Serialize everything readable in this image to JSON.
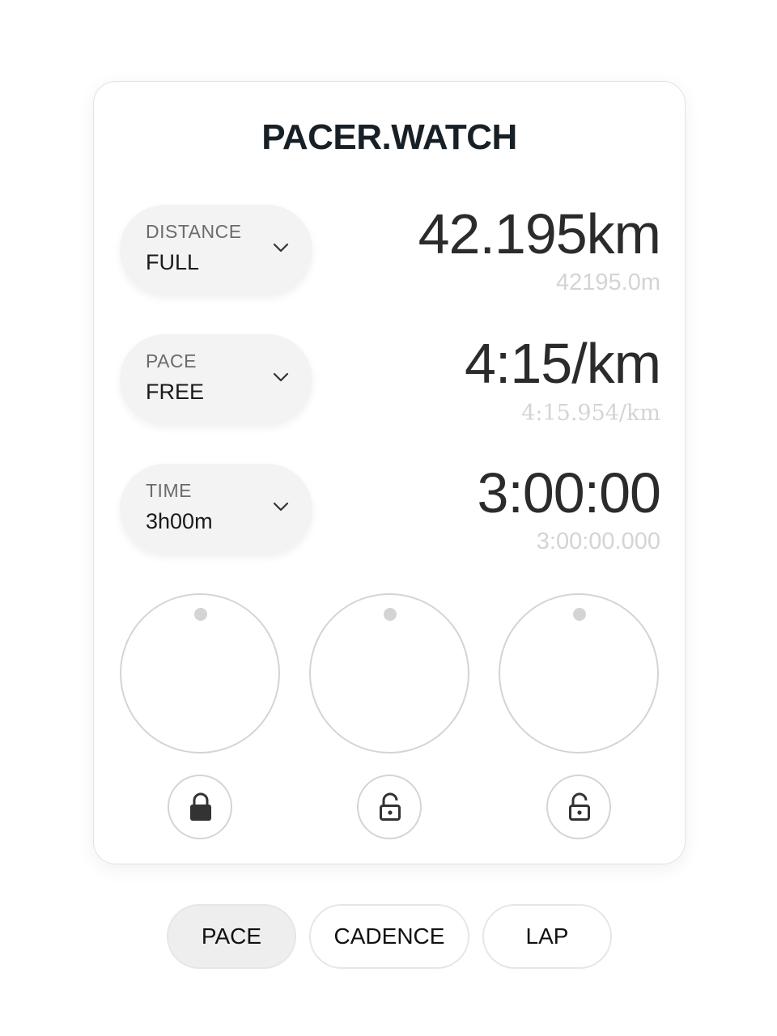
{
  "app": {
    "title": "PACER.WATCH"
  },
  "rows": [
    {
      "label": "DISTANCE",
      "selected": "FULL",
      "value": "42.195km",
      "precise": "42195.0m"
    },
    {
      "label": "PACE",
      "selected": "FREE",
      "value": "4:15/km",
      "precise": "4:15.954/km"
    },
    {
      "label": "TIME",
      "selected": "3h00m",
      "value": "3:00:00",
      "precise": "3:00:00.000"
    }
  ],
  "dials": [
    {
      "name": "distance-dial",
      "lock_state": "locked",
      "lock_icon": "lock-closed-icon"
    },
    {
      "name": "pace-dial",
      "lock_state": "unlocked",
      "lock_icon": "lock-open-icon"
    },
    {
      "name": "time-dial",
      "lock_state": "unlocked",
      "lock_icon": "lock-open-icon"
    }
  ],
  "tabs": [
    {
      "label": "PACE",
      "active": true
    },
    {
      "label": "CADENCE",
      "active": false
    },
    {
      "label": "LAP",
      "active": false
    }
  ],
  "colors": {
    "title": "#172026",
    "value": "#2b2b2b",
    "precise": "#d4d4d4",
    "selector_bg": "#f3f3f3",
    "dial_border": "#d4d4d4",
    "active_tab_bg": "#eeeeee",
    "lock_icon": "#333333"
  }
}
